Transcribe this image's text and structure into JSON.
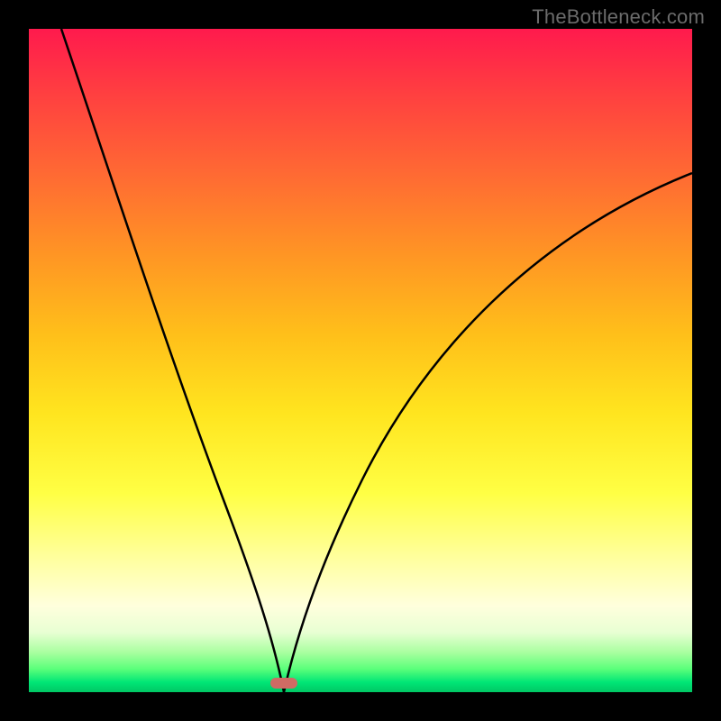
{
  "watermark": "TheBottleneck.com",
  "chart_data": {
    "type": "line",
    "title": "",
    "xlabel": "",
    "ylabel": "",
    "xlim": [
      0,
      100
    ],
    "ylim": [
      0,
      100
    ],
    "grid": false,
    "legend": false,
    "background_gradient": {
      "direction": "vertical",
      "stops": [
        {
          "pos": 0,
          "color": "#ff1a4d",
          "meaning": "high bottleneck"
        },
        {
          "pos": 50,
          "color": "#ffd81f",
          "meaning": "medium"
        },
        {
          "pos": 85,
          "color": "#ffff99",
          "meaning": "low"
        },
        {
          "pos": 100,
          "color": "#00c764",
          "meaning": "optimal"
        }
      ]
    },
    "optimum_x": 38,
    "marker": {
      "x": 38,
      "y": 0,
      "color": "#cf6b64"
    },
    "series": [
      {
        "name": "left-branch",
        "x": [
          0,
          5,
          10,
          15,
          20,
          25,
          30,
          34,
          36,
          37,
          38
        ],
        "y": [
          100,
          89,
          77,
          65,
          52,
          39,
          25,
          12,
          6,
          2,
          0
        ]
      },
      {
        "name": "right-branch",
        "x": [
          38,
          39,
          40,
          42,
          45,
          50,
          57,
          65,
          75,
          87,
          100
        ],
        "y": [
          0,
          2,
          5,
          10,
          18,
          29,
          41,
          52,
          62,
          71,
          78
        ]
      }
    ]
  }
}
